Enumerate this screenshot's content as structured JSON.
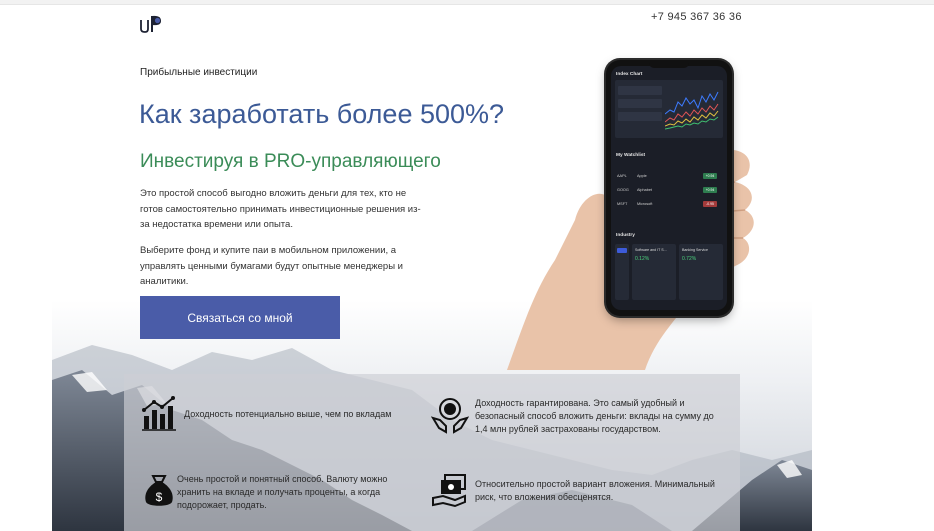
{
  "header": {
    "logo_text": "uP",
    "phone": "+7 945 367 36 36"
  },
  "hero": {
    "eyebrow": "Прибыльные инвестиции",
    "title": "Как заработать более 500%?",
    "subtitle": "Инвестируя в PRO-управляющего",
    "paragraph1": "Это простой способ выгодно вложить деньги для тех, кто не готов самостоятельно принимать инвестиционные решения из-за недостатка времени или опыта.",
    "paragraph2": "Выберите фонд и купите паи в мобильном приложении, а управлять ценными бумагами будут опытные менеджеры и аналитики.",
    "cta_label": "Связаться со мной",
    "cta_color": "#4a5ca8",
    "title_color": "#3c5a96",
    "subtitle_color": "#3b8c58"
  },
  "phone_screen": {
    "index_chart_title": "Index Chart",
    "watchlist_title": "My Watchlist",
    "industry_title": "Industry",
    "watchlist": [
      {
        "ticker": "AAPL",
        "name": "Apple",
        "change": "+0.94",
        "color": "#2e7d4f"
      },
      {
        "ticker": "GOOG",
        "name": "Alphabet",
        "change": "+0.94",
        "color": "#2e7d4f"
      },
      {
        "ticker": "MSFT",
        "name": "Microsoft",
        "change": "-0.95",
        "color": "#a33b3b"
      }
    ],
    "industry_cards": [
      {
        "name": "Software and IT S...",
        "value": "0.12%"
      },
      {
        "name": "Banking Service",
        "value": "0.72%"
      }
    ]
  },
  "features": [
    {
      "icon": "chart-growth-icon",
      "text": "Доходность потенциально выше, чем по вкладам"
    },
    {
      "icon": "coin-hands-icon",
      "text": "Доходность гарантирована. Это самый удобный и безопасный способ вложить деньги: вклады на сумму до 1,4 млн рублей застрахованы государством."
    },
    {
      "icon": "money-bag-icon",
      "text": "Очень простой и понятный способ. Валюту можно хранить на вкладе и получать проценты, а когда подорожает, продать."
    },
    {
      "icon": "cash-stack-icon",
      "text": "Относительно простой вариант вложения. Минимальный риск, что вложения обесценятся."
    }
  ]
}
